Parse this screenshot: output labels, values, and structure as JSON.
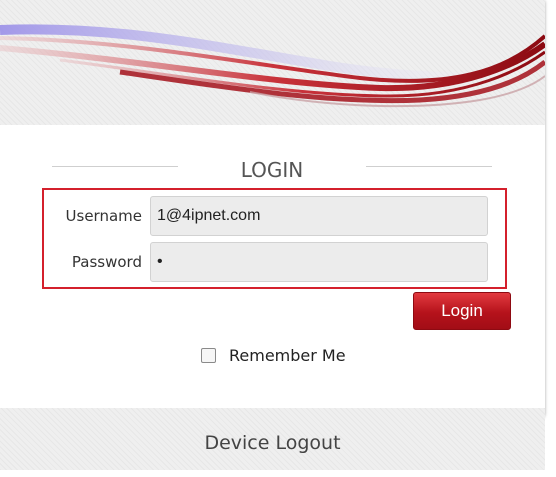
{
  "login": {
    "title": "LOGIN",
    "username_label": "Username",
    "username_value": "1@4ipnet.com",
    "password_label": "Password",
    "password_value": "•",
    "login_button": "Login",
    "remember_label": "Remember Me",
    "remember_checked": false
  },
  "footer": {
    "device_logout": "Device Logout"
  },
  "colors": {
    "accent_red": "#b5121b",
    "highlight_border": "#d4202c"
  },
  "icons": [
    "banner-swoosh-graphic",
    "checkbox-icon"
  ]
}
